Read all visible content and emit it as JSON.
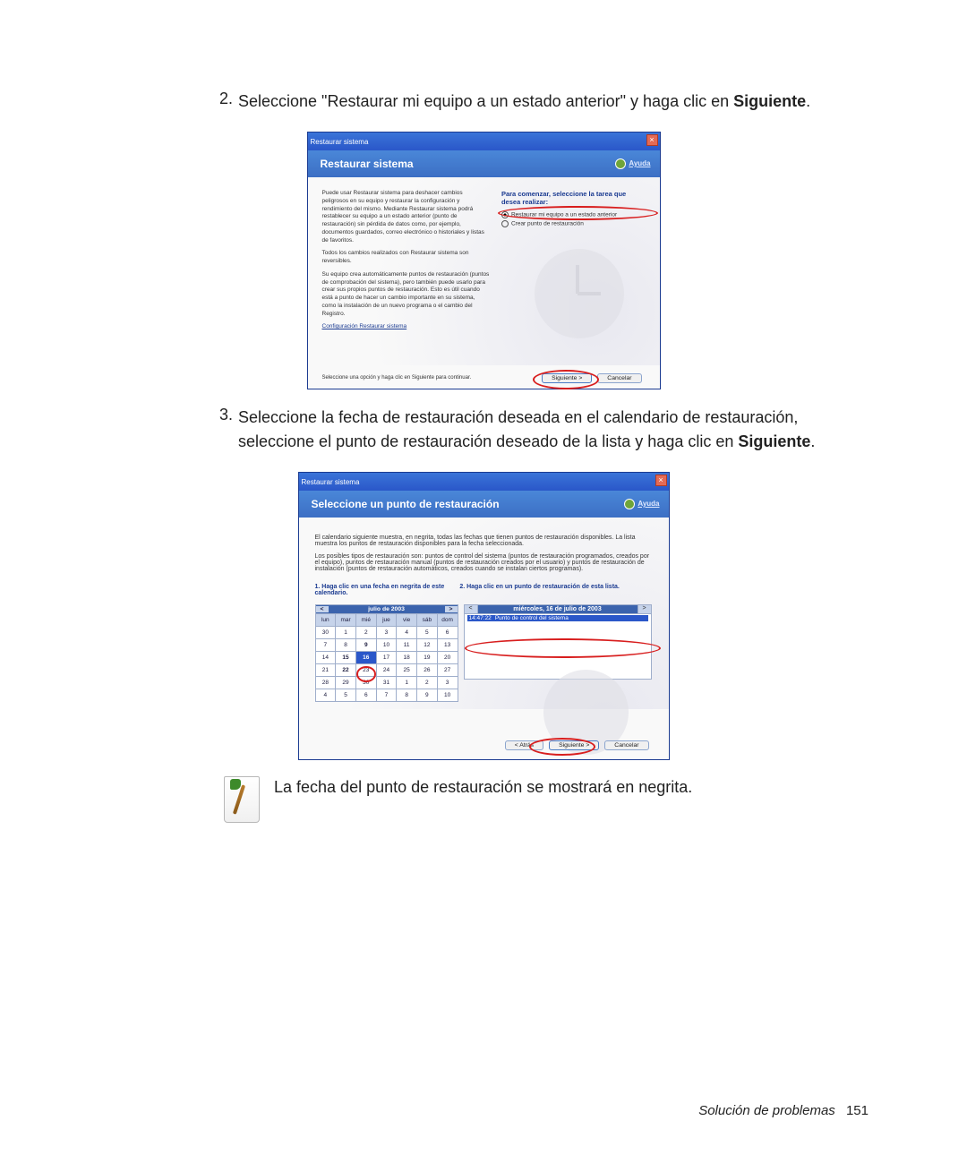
{
  "steps": {
    "s2_num": "2.",
    "s2_pre": "Seleccione \"Restaurar mi equipo a un estado anterior\" y haga clic en ",
    "s2_bold": "Siguiente",
    "s2_post": ".",
    "s3_num": "3.",
    "s3_pre": "Seleccione la fecha de restauración deseada en el calendario de restauración, seleccione el punto de restauración deseado de la lista y haga clic en ",
    "s3_bold": "Siguiente",
    "s3_post": "."
  },
  "ss1": {
    "window_title": "Restaurar sistema",
    "banner": "Restaurar sistema",
    "help": "Ayuda",
    "p1": "Puede usar Restaurar sistema para deshacer cambios peligrosos en su equipo y restaurar la configuración y rendimiento del mismo. Mediante Restaurar sistema podrá restablecer su equipo a un estado anterior (punto de restauración) sin pérdida de datos como, por ejemplo, documentos guardados, correo electrónico o historiales y listas de favoritos.",
    "p2": "Todos los cambios realizados con Restaurar sistema son reversibles.",
    "p3": "Su equipo crea automáticamente puntos de restauración (puntos de comprobación del sistema), pero también puede usarlo para crear sus propios puntos de restauración. Esto es útil cuando está a punto de hacer un cambio importante en su sistema, como la instalación de un nuevo programa o el cambio del Registro.",
    "config_link": "Configuración Restaurar sistema",
    "task_title": "Para comenzar, seleccione la tarea que desea realizar:",
    "radio1": "Restaurar mi equipo a un estado anterior",
    "radio2": "Crear punto de restauración",
    "hint": "Seleccione una opción y haga clic en Siguiente para continuar.",
    "btn_next": "Siguiente >",
    "btn_cancel": "Cancelar"
  },
  "ss2": {
    "window_title": "Restaurar sistema",
    "banner": "Seleccione un punto de restauración",
    "help": "Ayuda",
    "p1": "El calendario siguiente muestra, en negrita, todas las fechas que tienen puntos de restauración disponibles. La lista muestra los puntos de restauración disponibles para la fecha seleccionada.",
    "p2": "Los posibles tipos de restauración son: puntos de control del sistema (puntos de restauración programados, creados por el equipo), puntos de restauración manual (puntos de restauración creados por el usuario) y puntos de restauración de instalación (puntos de restauración automáticos, creados cuando se instalan ciertos programas).",
    "instr1": "1. Haga clic en una fecha en negrita de este calendario.",
    "instr2": "2. Haga clic en un punto de restauración de esta lista.",
    "cal_title": "julio de 2003",
    "days": [
      "lun",
      "mar",
      "mié",
      "jue",
      "vie",
      "sáb",
      "dom"
    ],
    "weeks": [
      [
        "30",
        "1",
        "2",
        "3",
        "4",
        "5",
        "6"
      ],
      [
        "7",
        "8",
        "9",
        "10",
        "11",
        "12",
        "13"
      ],
      [
        "14",
        "15",
        "16",
        "17",
        "18",
        "19",
        "20"
      ],
      [
        "21",
        "22",
        "23",
        "24",
        "25",
        "26",
        "27"
      ],
      [
        "28",
        "29",
        "30",
        "31",
        "1",
        "2",
        "3"
      ],
      [
        "4",
        "5",
        "6",
        "7",
        "8",
        "9",
        "10"
      ]
    ],
    "selected_day": "16",
    "list_date": "miércoles, 16 de julio de 2003",
    "rp_time": "14:47:22",
    "rp_label": "Punto de control del sistema",
    "btn_back": "< Atrás",
    "btn_next": "Siguiente >",
    "btn_cancel": "Cancelar"
  },
  "note": "La fecha del punto de restauración se mostrará en negrita.",
  "footer_section": "Solución de problemas",
  "footer_page": "151"
}
